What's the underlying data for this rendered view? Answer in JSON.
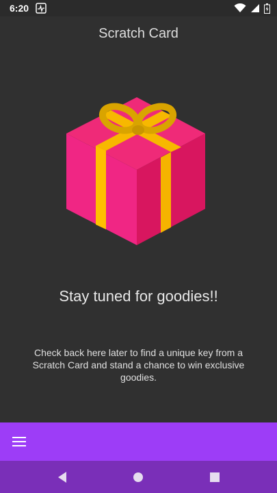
{
  "status_bar": {
    "time": "6:20",
    "icons": [
      "activity-icon",
      "wifi-icon",
      "signal-icon",
      "battery-icon"
    ]
  },
  "header": {
    "title": "Scratch Card"
  },
  "main": {
    "illustration": "gift-box-icon",
    "headline": "Stay tuned for goodies!!",
    "description": "Check back here later to find a unique key from a Scratch Card and stand a chance to win exclusive goodies."
  },
  "bottom_app_bar": {
    "menu_icon": "menu-icon"
  },
  "nav_bar": {
    "buttons": [
      "back-icon",
      "home-icon",
      "recents-icon"
    ]
  },
  "colors": {
    "background": "#303030",
    "app_bar": "#9d3df7",
    "nav_bar": "#7a2fb8",
    "gift_pink": "#f0287a",
    "ribbon": "#ffc000"
  }
}
